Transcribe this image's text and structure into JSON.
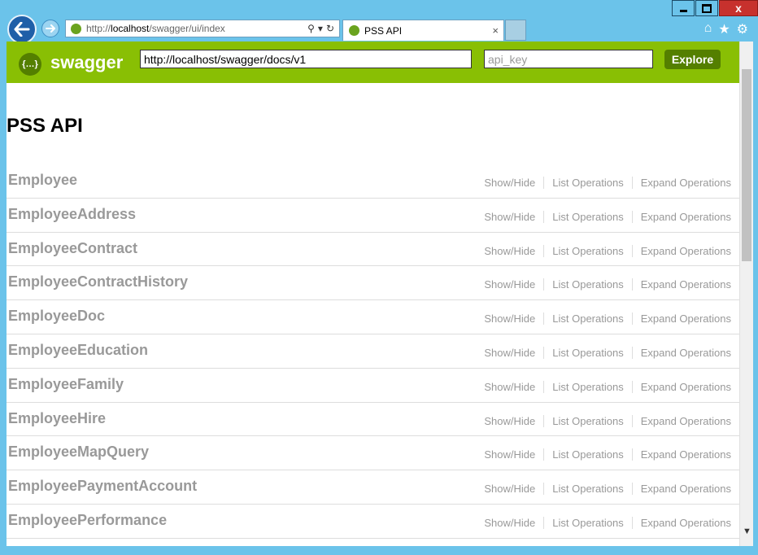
{
  "browser": {
    "address_url_prefix": "http://",
    "address_url_host": "localhost",
    "address_url_path": "/swagger/ui/index",
    "tab_title": "PSS API",
    "tab_close": "×"
  },
  "window": {
    "close": "x"
  },
  "swagger": {
    "brand": "swagger",
    "logo_glyph": "{…}",
    "docs_url": "http://localhost/swagger/docs/v1",
    "api_key_placeholder": "api_key",
    "explore_label": "Explore"
  },
  "page": {
    "title": "PSS API"
  },
  "ops_labels": {
    "show_hide": "Show/Hide",
    "list": "List Operations",
    "expand": "Expand Operations"
  },
  "resources": [
    "Employee",
    "EmployeeAddress",
    "EmployeeContract",
    "EmployeeContractHistory",
    "EmployeeDoc",
    "EmployeeEducation",
    "EmployeeFamily",
    "EmployeeHire",
    "EmployeeMapQuery",
    "EmployeePaymentAccount",
    "EmployeePerformance"
  ],
  "colors": {
    "swagger_green": "#89bf04",
    "swagger_dark": "#547f00",
    "chrome_blue": "#6bc3ea"
  }
}
